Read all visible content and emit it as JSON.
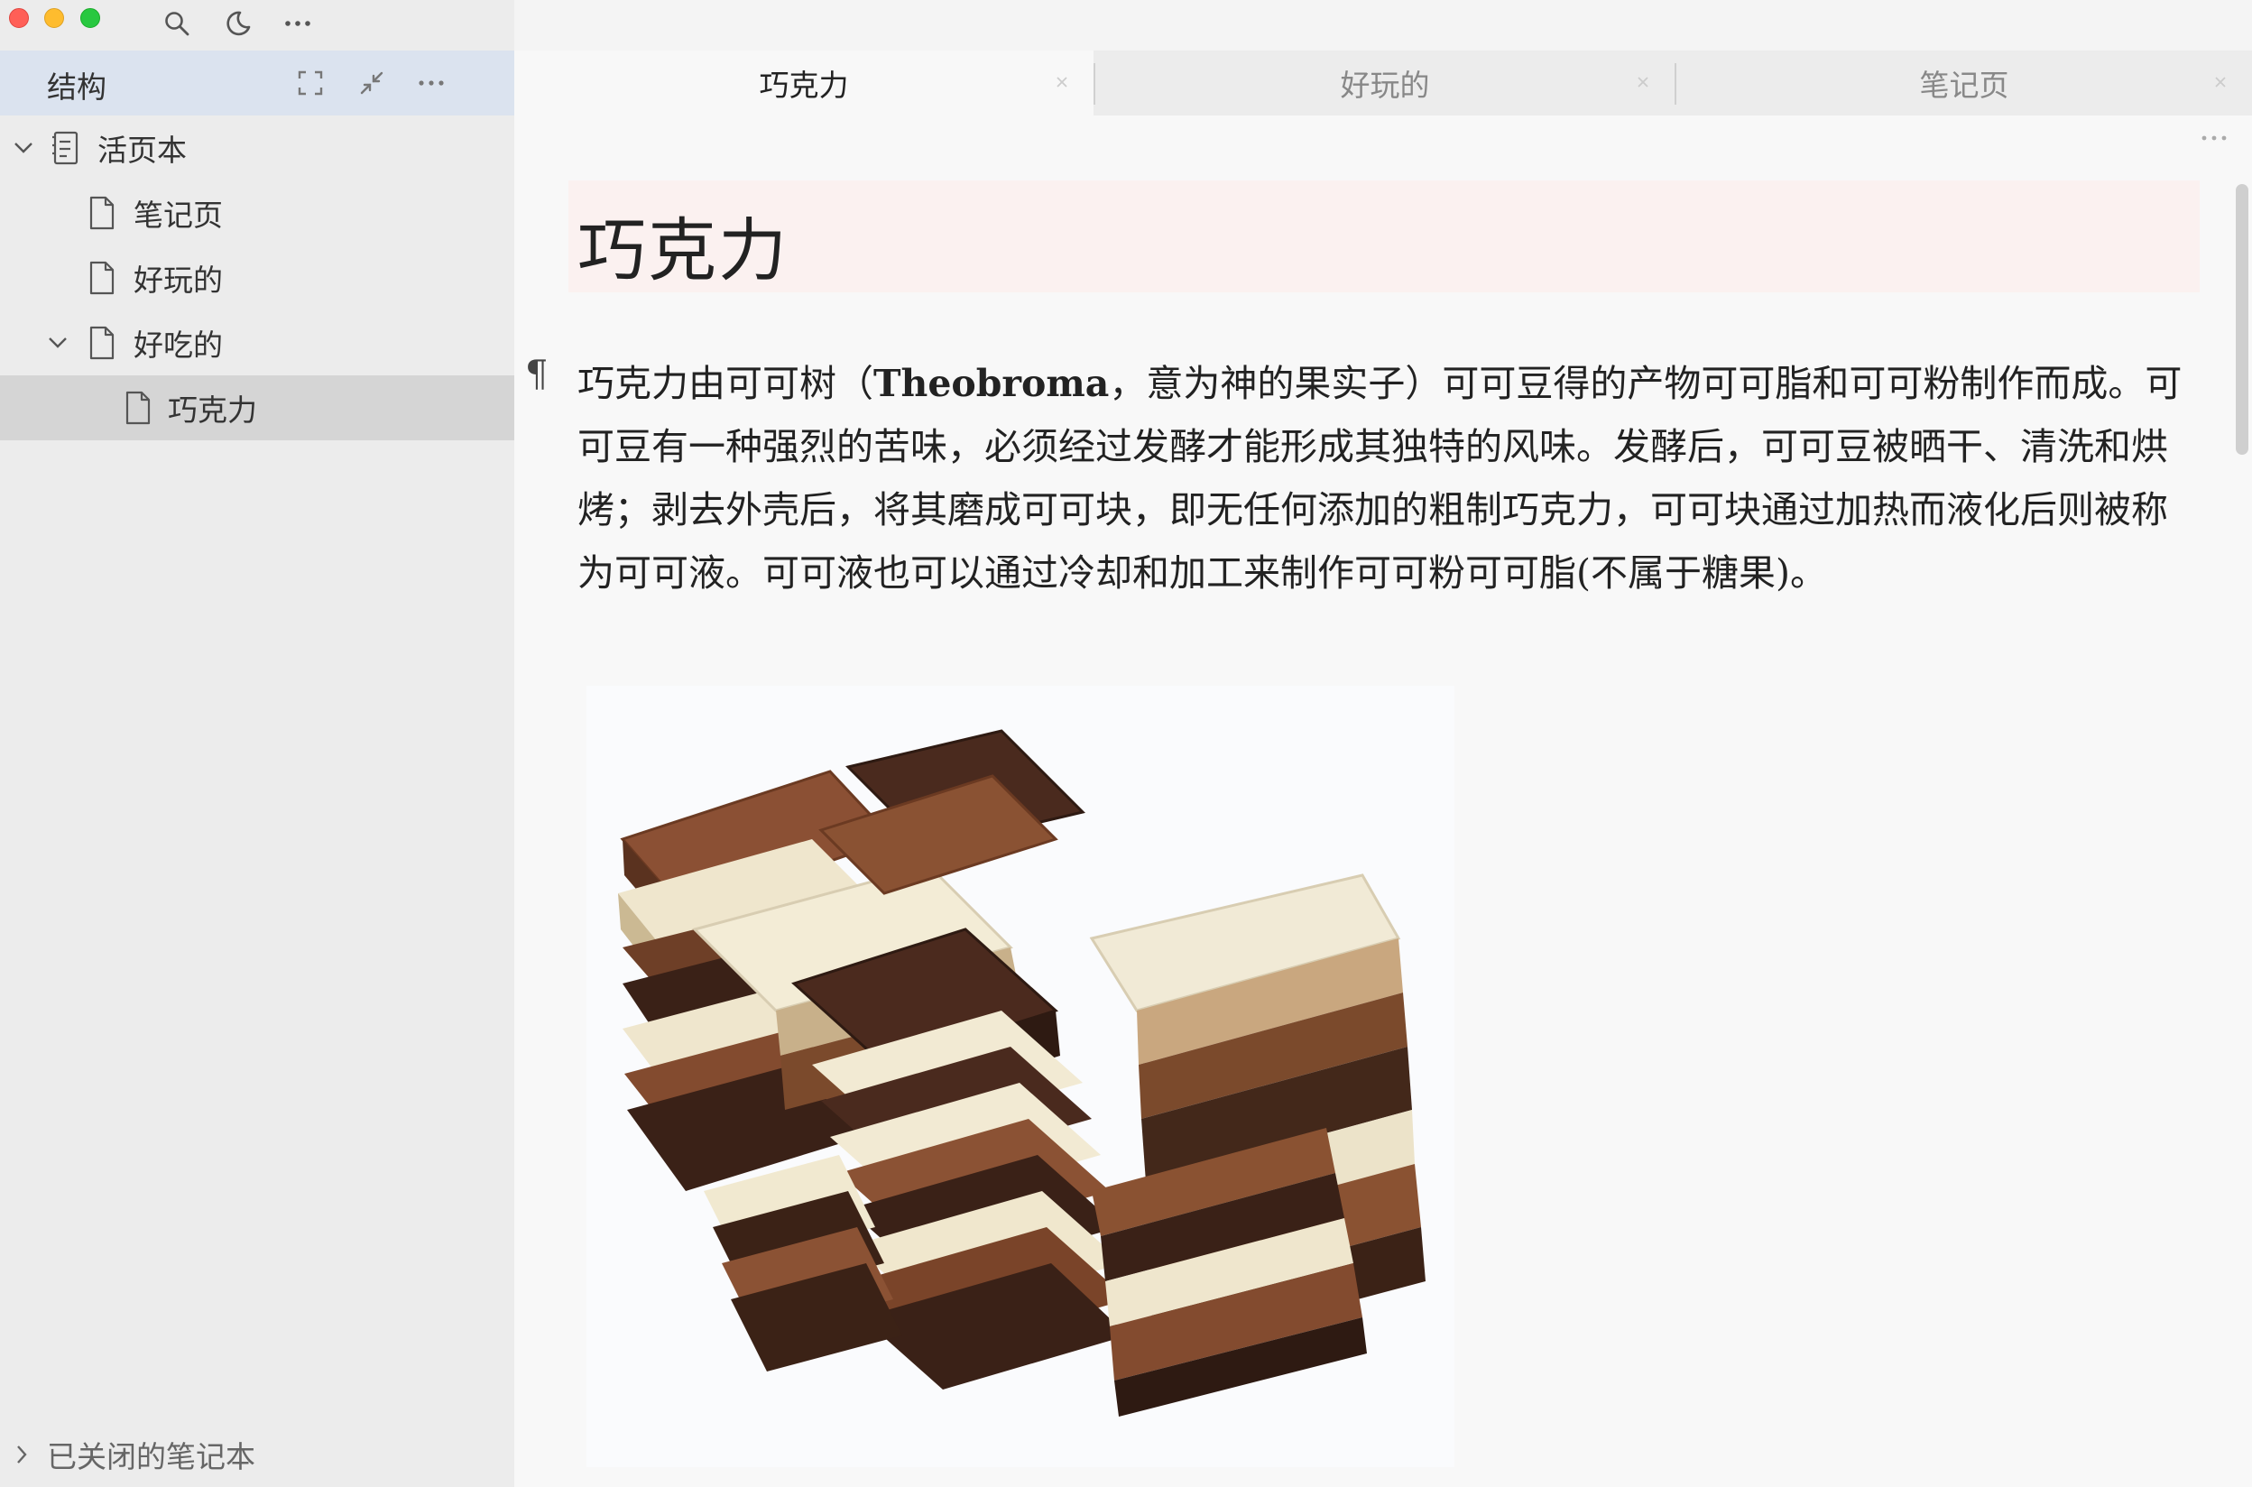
{
  "window": {
    "traffic_lights": [
      "close",
      "minimize",
      "zoom"
    ],
    "toolbar_icons": [
      "search-icon",
      "moon-icon",
      "more-icon"
    ]
  },
  "sidebar": {
    "title": "结构",
    "header_icons": [
      "expand-icon",
      "collapse-icon",
      "more-icon"
    ],
    "tree": [
      {
        "label": "活页本",
        "type": "notebook",
        "expanded": true,
        "level": 0
      },
      {
        "label": "笔记页",
        "type": "page",
        "level": 1
      },
      {
        "label": "好玩的",
        "type": "page",
        "level": 1
      },
      {
        "label": "好吃的",
        "type": "page",
        "expanded": true,
        "level": 1
      },
      {
        "label": "巧克力",
        "type": "page",
        "level": 2,
        "selected": true
      }
    ],
    "footer_label": "已关闭的笔记本"
  },
  "tabs": [
    {
      "label": "巧克力",
      "active": true
    },
    {
      "label": "好玩的",
      "active": false
    },
    {
      "label": "笔记页",
      "active": false
    }
  ],
  "document": {
    "title": "巧克力",
    "paragraph": {
      "before_bold": "巧克力由可可树（",
      "bold": "Theobroma",
      "after_bold": "，意为神的果实子）可可豆得的产物可可脂和可可粉制作而成。可可豆有一种强烈的苦味，必须经过发酵才能形成其独特的风味。发酵后，可可豆被晒干、清洗和烘烤；剥去外壳后，将其磨成可可块，即无任何添加的粗制巧克力，可可块通过加热而液化后则被称为可可液。可可液也可以通过冷却和加工来制作可可粉可可脂(不属于糖果)。"
    },
    "image_subject": "stacked chocolate bars"
  },
  "colors": {
    "sidebar_bg": "#ececec",
    "sidebar_header_bg": "#dbe3ef",
    "selected_row_bg": "#d5d5d5",
    "title_block_bg": "#fbf1f0",
    "content_bg": "#f8f8f8"
  }
}
